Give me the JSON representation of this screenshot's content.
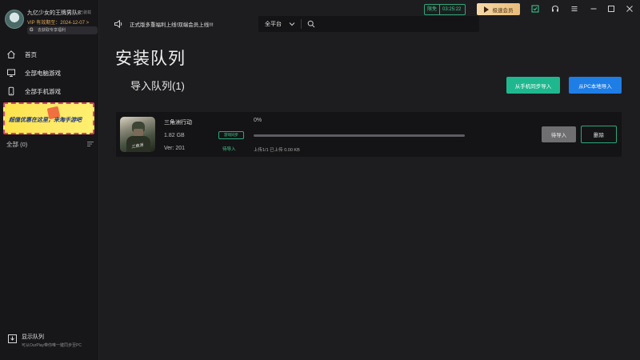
{
  "profile": {
    "name": "九亿少女的王牌男队8",
    "name_sub": "已装载",
    "vip": "VIP 有效期至：2024-12-07  >",
    "game_tag_icon": "G",
    "game_tag": "去获取专享福利"
  },
  "sidebar": {
    "items": [
      {
        "label": "首页",
        "icon": "home-icon"
      },
      {
        "label": "全部电脑游戏",
        "icon": "monitor-icon"
      },
      {
        "label": "全部手机游戏",
        "icon": "phone-icon"
      }
    ],
    "promo_text": "超值优惠在这里，来淘手游吧",
    "all_label": "全部 (0)",
    "footer_title": "显示队列",
    "footer_sub": "可从OurPlay带你唯一键同步至PC"
  },
  "topbar": {
    "notice": "正式版多重福利上线!双端会员上线!!!",
    "platform": "全平台",
    "timer_label": "限免",
    "timer_value": "03:25:22",
    "vip_button": "极速会员"
  },
  "main": {
    "page_title": "安装队列",
    "queue_title": "导入队列(1)",
    "btn_phone": "从手机同步导入",
    "btn_pc": "从PC本地导入"
  },
  "queue": [
    {
      "name": "三角洲行动",
      "size": "1.82 GB",
      "version": "Ver: 201",
      "sync_tag": "游戏同步",
      "status": "待导入",
      "percent": "0%",
      "progress": 0,
      "upload_info": "上传1/1  已上传 0.00 KB",
      "btn_import": "待导入",
      "btn_delete": "删除",
      "thumb_logo": "三角洲"
    }
  ],
  "colors": {
    "accent_green": "#1fb88e",
    "accent_blue": "#1f7de6",
    "background": "#1d1d20",
    "sidebar": "#17171a"
  }
}
